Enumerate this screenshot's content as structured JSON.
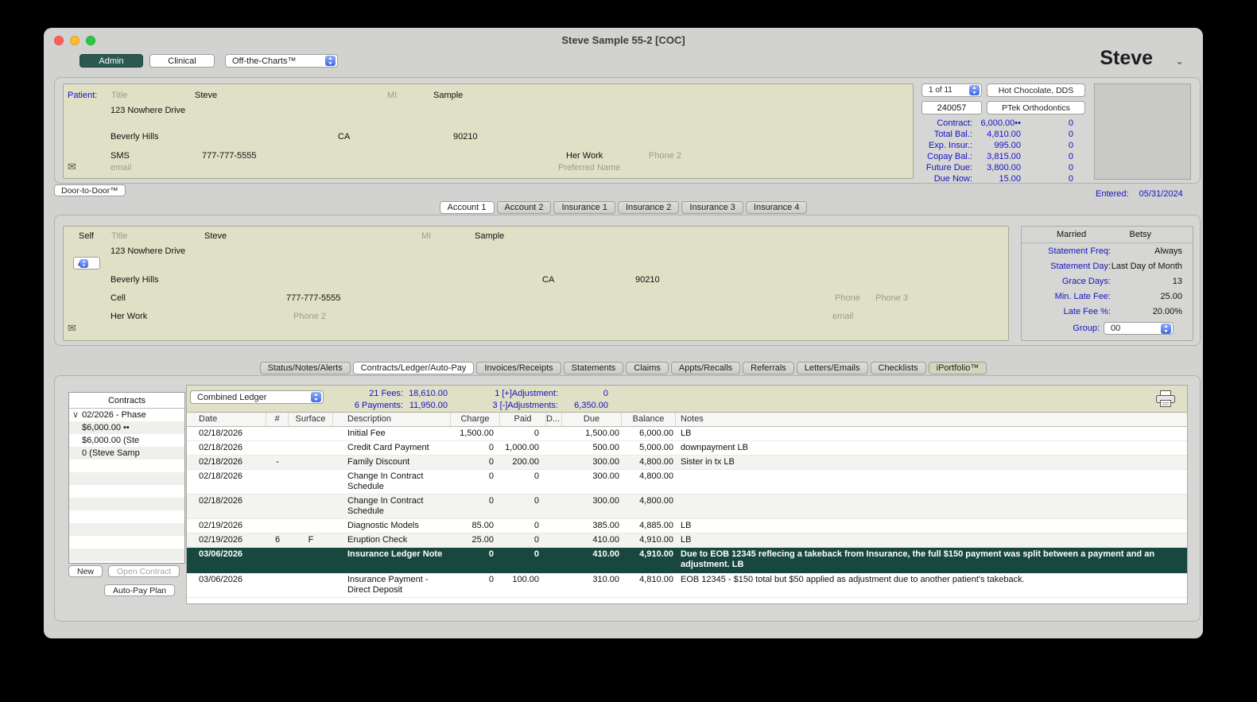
{
  "colors": {
    "accent_teal": "#2b584f",
    "selected_row": "#17473f",
    "panel_olive": "#dfe0c5",
    "link_blue": "#1414c4"
  },
  "icons": {
    "envelope": "✉",
    "user_chevron": "⌄",
    "disclosure": "∨"
  },
  "window": {
    "title": "Steve Sample 55-2 [COC]"
  },
  "toolbar": {
    "admin_label": "Admin",
    "clinical_label": "Clinical",
    "module_select": "Off-the-Charts™",
    "user_name": "Steve"
  },
  "patient": {
    "label": "Patient:",
    "title_ph": "Title",
    "first": "Steve",
    "mi_label": "MI",
    "last": "Sample",
    "street": "123 Nowhere Drive",
    "city": "Beverly Hills",
    "state": "CA",
    "zip": "90210",
    "phone_type": "SMS",
    "phone": "777-777-5555",
    "work_label": "Her Work",
    "phone2_ph": "Phone 2",
    "email_ph": "email",
    "preferred_ph": "Preferred Name"
  },
  "patient_summary": {
    "pager": "1 of 11",
    "doctor": "Hot Chocolate, DDS",
    "chart_number": "240057",
    "practice": "PTek Orthodontics",
    "fin": [
      {
        "label": "Contract:",
        "value": "6,000.00••",
        "right": "0"
      },
      {
        "label": "Total Bal.:",
        "value": "4,810.00",
        "right": "0"
      },
      {
        "label": "Exp. Insur.:",
        "value": "995.00",
        "right": "0"
      },
      {
        "label": "Copay Bal.:",
        "value": "3,815.00",
        "right": "0"
      },
      {
        "label": "Future Due:",
        "value": "3,800.00",
        "right": "0"
      },
      {
        "label": "Due Now:",
        "value": "15.00",
        "right": "0"
      }
    ],
    "entered_label": "Entered:",
    "entered_value": "05/31/2024"
  },
  "door_to_door_label": "Door-to-Door™",
  "account_tabs": [
    {
      "label": "Account 1",
      "selected": true
    },
    {
      "label": "Account 2"
    },
    {
      "label": "Insurance 1"
    },
    {
      "label": "Insurance 2"
    },
    {
      "label": "Insurance 3"
    },
    {
      "label": "Insurance 4"
    }
  ],
  "account": {
    "self_label": "Self",
    "title_ph": "Title",
    "first": "Steve",
    "mi_label": "MI",
    "last": "Sample",
    "street": "123 Nowhere Drive",
    "type_value": "Δ",
    "city": "Beverly Hills",
    "state": "CA",
    "zip": "90210",
    "cell_label": "Cell",
    "cell": "777-777-5555",
    "phone_ph": "Phone",
    "phone3_ph": "Phone 3",
    "work_label": "Her Work",
    "phone2_ph": "Phone 2",
    "email_ph": "email"
  },
  "billing": {
    "marital_status": "Married",
    "spouse": "Betsy",
    "rows": [
      {
        "label": "Statement Freq:",
        "value": "Always"
      },
      {
        "label": "Statement Day:",
        "value": "Last Day of Month"
      },
      {
        "label": "Grace Days:",
        "value": "13"
      },
      {
        "label": "Min. Late Fee:",
        "value": "25.00"
      },
      {
        "label": "Late Fee %:",
        "value": "20.00%"
      }
    ],
    "group_label": "Group:",
    "group_value": "00"
  },
  "main_tabs": [
    {
      "label": "Status/Notes/Alerts"
    },
    {
      "label": "Contracts/Ledger/Auto-Pay",
      "selected": true
    },
    {
      "label": "Invoices/Receipts"
    },
    {
      "label": "Statements"
    },
    {
      "label": "Claims"
    },
    {
      "label": "Appts/Recalls"
    },
    {
      "label": "Referrals"
    },
    {
      "label": "Letters/Emails"
    },
    {
      "label": "Checklists"
    },
    {
      "label": "iPortfolio™",
      "accent": true
    }
  ],
  "contracts": {
    "header": "Contracts",
    "tree": [
      {
        "label": "02/2026 - Phase",
        "expanded": true
      },
      {
        "label": "$6,000.00 ••"
      },
      {
        "label": "$6,000.00 (Ste"
      },
      {
        "label": "0 (Steve Samp"
      }
    ],
    "new_button": "New",
    "open_button": "Open Contract",
    "autopay_button": "Auto-Pay Plan"
  },
  "ledger": {
    "view_select": "Combined Ledger",
    "stats": {
      "fees_label": "21 Fees:",
      "fees_value": "18,610.00",
      "payments_label": "6 Payments:",
      "payments_value": "11,950.00",
      "pos_adj_label": "1 [+]Adjustment:",
      "pos_adj_value": "0",
      "neg_adj_label": "3 [-]Adjustments:",
      "neg_adj_value": "6,350.00"
    },
    "columns": [
      "Date",
      "#",
      "Surface",
      "Description",
      "Charge",
      "Paid",
      "D...",
      "Due",
      "Balance",
      "Notes"
    ],
    "rows": [
      {
        "date": "02/18/2026",
        "num": "",
        "surface": "",
        "desc": "Initial Fee",
        "charge": "1,500.00",
        "paid": "0",
        "d": "",
        "due": "1,500.00",
        "balance": "6,000.00",
        "notes": "LB"
      },
      {
        "date": "02/18/2026",
        "num": "",
        "surface": "",
        "desc": "Credit Card Payment",
        "charge": "0",
        "paid": "1,000.00",
        "d": "",
        "due": "500.00",
        "balance": "5,000.00",
        "notes": "downpayment LB"
      },
      {
        "date": "02/18/2026",
        "num": "-",
        "surface": "",
        "desc": "Family Discount",
        "charge": "0",
        "paid": "200.00",
        "d": "",
        "due": "300.00",
        "balance": "4,800.00",
        "notes": "Sister in tx LB"
      },
      {
        "date": "02/18/2026",
        "num": "",
        "surface": "",
        "desc": "Change In Contract Schedule",
        "charge": "0",
        "paid": "0",
        "d": "",
        "due": "300.00",
        "balance": "4,800.00",
        "notes": ""
      },
      {
        "date": "02/18/2026",
        "num": "",
        "surface": "",
        "desc": "Change In Contract Schedule",
        "charge": "0",
        "paid": "0",
        "d": "",
        "due": "300.00",
        "balance": "4,800.00",
        "notes": ""
      },
      {
        "date": "02/19/2026",
        "num": "",
        "surface": "",
        "desc": "Diagnostic Models",
        "charge": "85.00",
        "paid": "0",
        "d": "",
        "due": "385.00",
        "balance": "4,885.00",
        "notes": "LB"
      },
      {
        "date": "02/19/2026",
        "num": "6",
        "surface": "F",
        "desc": "Eruption Check",
        "charge": "25.00",
        "paid": "0",
        "d": "",
        "due": "410.00",
        "balance": "4,910.00",
        "notes": "LB"
      },
      {
        "date": "03/06/2026",
        "num": "",
        "surface": "",
        "desc": "Insurance Ledger Note",
        "charge": "0",
        "paid": "0",
        "d": "",
        "due": "410.00",
        "balance": "4,910.00",
        "notes": "Due to EOB 12345 reflecing a takeback from Insurance, the full $150 payment was split between a payment and an adjustment. LB",
        "selected": true
      },
      {
        "date": "03/06/2026",
        "num": "",
        "surface": "",
        "desc": "Insurance Payment - Direct Deposit",
        "charge": "0",
        "paid": "100.00",
        "d": "",
        "due": "310.00",
        "balance": "4,810.00",
        "notes": "EOB 12345 - $150 total but $50 applied as adjustment due to another patient's takeback."
      }
    ]
  }
}
